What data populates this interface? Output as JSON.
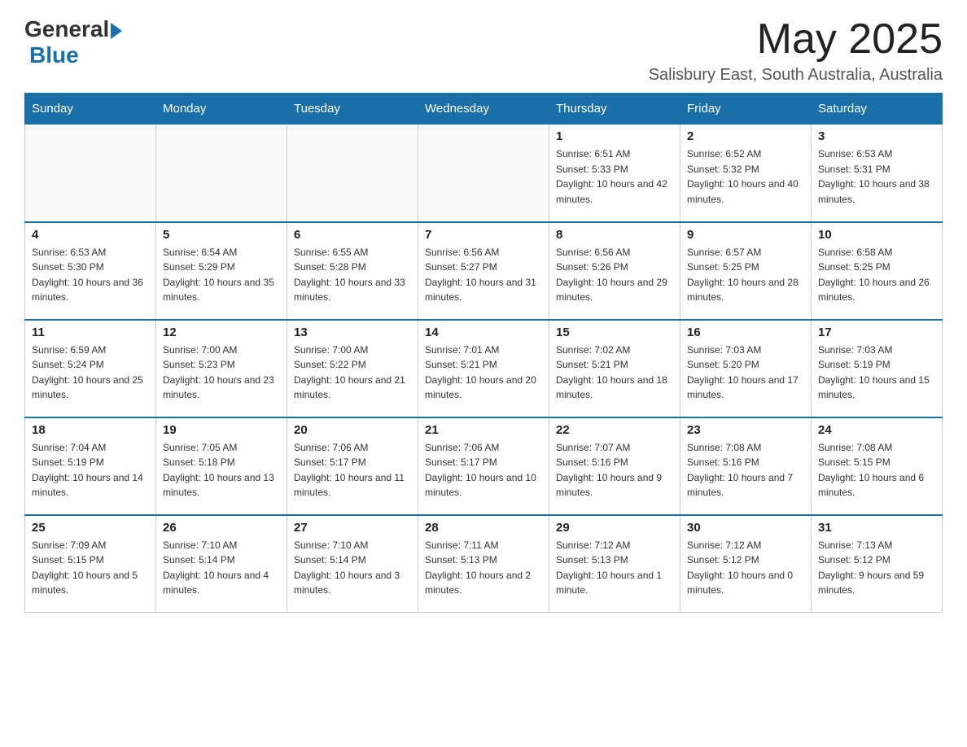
{
  "logo": {
    "general": "General",
    "blue": "Blue"
  },
  "header": {
    "month_year": "May 2025",
    "location": "Salisbury East, South Australia, Australia"
  },
  "weekdays": [
    "Sunday",
    "Monday",
    "Tuesday",
    "Wednesday",
    "Thursday",
    "Friday",
    "Saturday"
  ],
  "weeks": [
    [
      {
        "day": "",
        "info": ""
      },
      {
        "day": "",
        "info": ""
      },
      {
        "day": "",
        "info": ""
      },
      {
        "day": "",
        "info": ""
      },
      {
        "day": "1",
        "info": "Sunrise: 6:51 AM\nSunset: 5:33 PM\nDaylight: 10 hours and 42 minutes."
      },
      {
        "day": "2",
        "info": "Sunrise: 6:52 AM\nSunset: 5:32 PM\nDaylight: 10 hours and 40 minutes."
      },
      {
        "day": "3",
        "info": "Sunrise: 6:53 AM\nSunset: 5:31 PM\nDaylight: 10 hours and 38 minutes."
      }
    ],
    [
      {
        "day": "4",
        "info": "Sunrise: 6:53 AM\nSunset: 5:30 PM\nDaylight: 10 hours and 36 minutes."
      },
      {
        "day": "5",
        "info": "Sunrise: 6:54 AM\nSunset: 5:29 PM\nDaylight: 10 hours and 35 minutes."
      },
      {
        "day": "6",
        "info": "Sunrise: 6:55 AM\nSunset: 5:28 PM\nDaylight: 10 hours and 33 minutes."
      },
      {
        "day": "7",
        "info": "Sunrise: 6:56 AM\nSunset: 5:27 PM\nDaylight: 10 hours and 31 minutes."
      },
      {
        "day": "8",
        "info": "Sunrise: 6:56 AM\nSunset: 5:26 PM\nDaylight: 10 hours and 29 minutes."
      },
      {
        "day": "9",
        "info": "Sunrise: 6:57 AM\nSunset: 5:25 PM\nDaylight: 10 hours and 28 minutes."
      },
      {
        "day": "10",
        "info": "Sunrise: 6:58 AM\nSunset: 5:25 PM\nDaylight: 10 hours and 26 minutes."
      }
    ],
    [
      {
        "day": "11",
        "info": "Sunrise: 6:59 AM\nSunset: 5:24 PM\nDaylight: 10 hours and 25 minutes."
      },
      {
        "day": "12",
        "info": "Sunrise: 7:00 AM\nSunset: 5:23 PM\nDaylight: 10 hours and 23 minutes."
      },
      {
        "day": "13",
        "info": "Sunrise: 7:00 AM\nSunset: 5:22 PM\nDaylight: 10 hours and 21 minutes."
      },
      {
        "day": "14",
        "info": "Sunrise: 7:01 AM\nSunset: 5:21 PM\nDaylight: 10 hours and 20 minutes."
      },
      {
        "day": "15",
        "info": "Sunrise: 7:02 AM\nSunset: 5:21 PM\nDaylight: 10 hours and 18 minutes."
      },
      {
        "day": "16",
        "info": "Sunrise: 7:03 AM\nSunset: 5:20 PM\nDaylight: 10 hours and 17 minutes."
      },
      {
        "day": "17",
        "info": "Sunrise: 7:03 AM\nSunset: 5:19 PM\nDaylight: 10 hours and 15 minutes."
      }
    ],
    [
      {
        "day": "18",
        "info": "Sunrise: 7:04 AM\nSunset: 5:19 PM\nDaylight: 10 hours and 14 minutes."
      },
      {
        "day": "19",
        "info": "Sunrise: 7:05 AM\nSunset: 5:18 PM\nDaylight: 10 hours and 13 minutes."
      },
      {
        "day": "20",
        "info": "Sunrise: 7:06 AM\nSunset: 5:17 PM\nDaylight: 10 hours and 11 minutes."
      },
      {
        "day": "21",
        "info": "Sunrise: 7:06 AM\nSunset: 5:17 PM\nDaylight: 10 hours and 10 minutes."
      },
      {
        "day": "22",
        "info": "Sunrise: 7:07 AM\nSunset: 5:16 PM\nDaylight: 10 hours and 9 minutes."
      },
      {
        "day": "23",
        "info": "Sunrise: 7:08 AM\nSunset: 5:16 PM\nDaylight: 10 hours and 7 minutes."
      },
      {
        "day": "24",
        "info": "Sunrise: 7:08 AM\nSunset: 5:15 PM\nDaylight: 10 hours and 6 minutes."
      }
    ],
    [
      {
        "day": "25",
        "info": "Sunrise: 7:09 AM\nSunset: 5:15 PM\nDaylight: 10 hours and 5 minutes."
      },
      {
        "day": "26",
        "info": "Sunrise: 7:10 AM\nSunset: 5:14 PM\nDaylight: 10 hours and 4 minutes."
      },
      {
        "day": "27",
        "info": "Sunrise: 7:10 AM\nSunset: 5:14 PM\nDaylight: 10 hours and 3 minutes."
      },
      {
        "day": "28",
        "info": "Sunrise: 7:11 AM\nSunset: 5:13 PM\nDaylight: 10 hours and 2 minutes."
      },
      {
        "day": "29",
        "info": "Sunrise: 7:12 AM\nSunset: 5:13 PM\nDaylight: 10 hours and 1 minute."
      },
      {
        "day": "30",
        "info": "Sunrise: 7:12 AM\nSunset: 5:12 PM\nDaylight: 10 hours and 0 minutes."
      },
      {
        "day": "31",
        "info": "Sunrise: 7:13 AM\nSunset: 5:12 PM\nDaylight: 9 hours and 59 minutes."
      }
    ]
  ]
}
